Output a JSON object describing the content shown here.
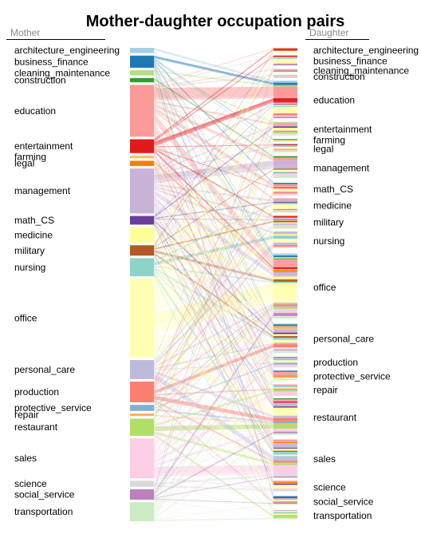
{
  "chart_data": {
    "type": "parallel-sets",
    "title": "Mother-daughter occupation pairs",
    "left_axis_label": "Mother",
    "right_axis_label": "Daughter",
    "categories": [
      "architecture_engineering",
      "business_finance",
      "cleaning_maintenance",
      "construction",
      "education",
      "entertainment",
      "farming",
      "legal",
      "management",
      "math_CS",
      "medicine",
      "military",
      "nursing",
      "office",
      "personal_care",
      "production",
      "protective_service",
      "repair",
      "restaurant",
      "sales",
      "science",
      "social_service",
      "transportation"
    ],
    "colors": {
      "architecture_engineering": "#a6cee3",
      "business_finance": "#1f78b4",
      "cleaning_maintenance": "#b2df8a",
      "construction": "#33a02c",
      "education": "#fb9a99",
      "entertainment": "#e31a1c",
      "farming": "#fdbf6f",
      "legal": "#ff7f00",
      "management": "#cab2d6",
      "math_CS": "#6a3d9a",
      "medicine": "#ffff99",
      "military": "#b15928",
      "nursing": "#8dd3c7",
      "office": "#ffffb3",
      "personal_care": "#bebada",
      "production": "#fb8072",
      "protective_service": "#80b1d3",
      "repair": "#fdb462",
      "restaurant": "#b3de69",
      "sales": "#fccde5",
      "science": "#d9d9d9",
      "social_service": "#bc80bd",
      "transportation": "#ccebc5"
    },
    "mother_counts": {
      "architecture_engineering": 6,
      "business_finance": 14,
      "cleaning_maintenance": 6,
      "construction": 5,
      "education": 60,
      "entertainment": 16,
      "farming": 3,
      "legal": 6,
      "management": 52,
      "math_CS": 10,
      "medicine": 18,
      "military": 12,
      "nursing": 21,
      "office": 91,
      "personal_care": 22,
      "production": 24,
      "protective_service": 7,
      "repair": 3,
      "restaurant": 20,
      "sales": 46,
      "science": 7,
      "social_service": 12,
      "transportation": 22
    },
    "daughter_counts": {
      "architecture_engineering": 6,
      "business_finance": 14,
      "cleaning_maintenance": 4,
      "construction": 4,
      "education": 48,
      "entertainment": 18,
      "farming": 3,
      "legal": 12,
      "management": 30,
      "math_CS": 16,
      "medicine": 18,
      "military": 17,
      "nursing": 24,
      "office": 84,
      "personal_care": 38,
      "production": 14,
      "protective_service": 14,
      "repair": 14,
      "restaurant": 48,
      "sales": 48,
      "science": 16,
      "social_service": 14,
      "transportation": 14
    },
    "major_flows": [
      {
        "from": "education",
        "to": "education",
        "value": 12
      },
      {
        "from": "office",
        "to": "office",
        "value": 14
      },
      {
        "from": "management",
        "to": "management",
        "value": 6
      },
      {
        "from": "sales",
        "to": "sales",
        "value": 8
      },
      {
        "from": "restaurant",
        "to": "restaurant",
        "value": 5
      },
      {
        "from": "production",
        "to": "personal_care",
        "value": 4
      },
      {
        "from": "production",
        "to": "restaurant",
        "value": 4
      },
      {
        "from": "nursing",
        "to": "nursing",
        "value": 4
      },
      {
        "from": "entertainment",
        "to": "education",
        "value": 3
      },
      {
        "from": "business_finance",
        "to": "education",
        "value": 2
      }
    ]
  }
}
